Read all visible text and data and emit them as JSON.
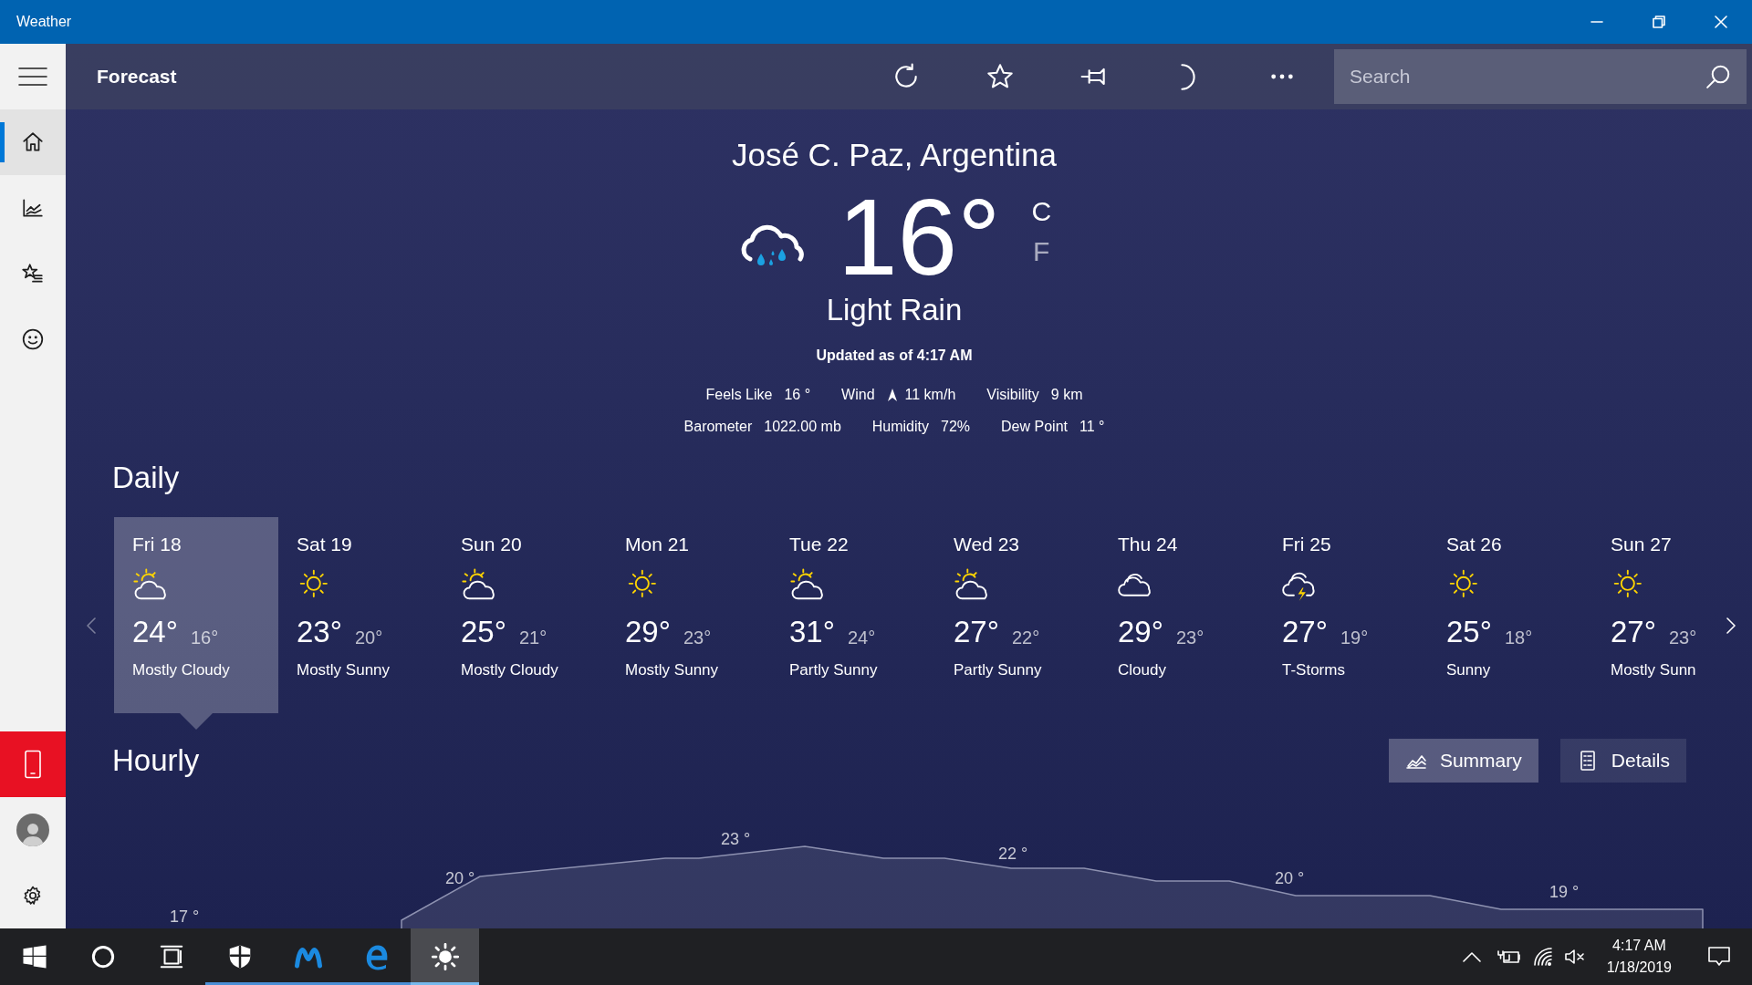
{
  "window": {
    "title": "Weather"
  },
  "sidebar": {
    "items": [
      {
        "kind": "home",
        "selected": true
      },
      {
        "kind": "chart",
        "selected": false
      },
      {
        "kind": "favorites",
        "selected": false
      },
      {
        "kind": "feedback",
        "selected": false
      }
    ],
    "bottom": [
      {
        "kind": "phone"
      },
      {
        "kind": "avatar"
      },
      {
        "kind": "settings"
      }
    ]
  },
  "app_bar": {
    "title": "Forecast",
    "actions": [
      {
        "kind": "refresh"
      },
      {
        "kind": "favorite"
      },
      {
        "kind": "pin"
      },
      {
        "kind": "theme"
      },
      {
        "kind": "more"
      }
    ],
    "search": {
      "placeholder": "Search"
    }
  },
  "current": {
    "location": "José C. Paz, Argentina",
    "temperature": "16°",
    "units": [
      {
        "label": "C",
        "selected": true
      },
      {
        "label": "F",
        "selected": false
      }
    ],
    "condition": "Light Rain",
    "updated": "Updated as of 4:17 AM",
    "details": [
      [
        {
          "label": "Feels Like",
          "value": "16 °",
          "arrow": false
        },
        {
          "label": "Wind",
          "value": "11 km/h",
          "arrow": true
        },
        {
          "label": "Visibility",
          "value": "9 km",
          "arrow": false
        }
      ],
      [
        {
          "label": "Barometer",
          "value": "1022.00 mb",
          "arrow": false
        },
        {
          "label": "Humidity",
          "value": "72%",
          "arrow": false
        },
        {
          "label": "Dew Point",
          "value": "11 °",
          "arrow": false
        }
      ]
    ]
  },
  "daily": {
    "heading": "Daily",
    "days": [
      {
        "day": "Fri 18",
        "kind": "partly",
        "high": "24°",
        "low": "16°",
        "condition": "Mostly Cloudy",
        "selected": true
      },
      {
        "day": "Sat 19",
        "kind": "sunny",
        "high": "23°",
        "low": "20°",
        "condition": "Mostly Sunny",
        "selected": false
      },
      {
        "day": "Sun 20",
        "kind": "partly",
        "high": "25°",
        "low": "21°",
        "condition": "Mostly Cloudy",
        "selected": false
      },
      {
        "day": "Mon 21",
        "kind": "sunny",
        "high": "29°",
        "low": "23°",
        "condition": "Mostly Sunny",
        "selected": false
      },
      {
        "day": "Tue 22",
        "kind": "partly",
        "high": "31°",
        "low": "24°",
        "condition": "Partly Sunny",
        "selected": false
      },
      {
        "day": "Wed 23",
        "kind": "partly",
        "high": "27°",
        "low": "22°",
        "condition": "Partly Sunny",
        "selected": false
      },
      {
        "day": "Thu 24",
        "kind": "cloudy",
        "high": "29°",
        "low": "23°",
        "condition": "Cloudy",
        "selected": false
      },
      {
        "day": "Fri 25",
        "kind": "storm",
        "high": "27°",
        "low": "19°",
        "condition": "T-Storms",
        "selected": false
      },
      {
        "day": "Sat 26",
        "kind": "sunny",
        "high": "25°",
        "low": "18°",
        "condition": "Sunny",
        "selected": false
      },
      {
        "day": "Sun 27",
        "kind": "sunny",
        "high": "27°",
        "low": "23°",
        "condition": "Mostly Sunn",
        "selected": false
      }
    ]
  },
  "hourly": {
    "heading": "Hourly",
    "views": [
      {
        "label": "Summary",
        "kind": "summary",
        "selected": true
      },
      {
        "label": "Details",
        "kind": "details",
        "selected": false
      }
    ],
    "labels": [
      "17 °",
      "20 °",
      "23 °",
      "22 °",
      "20 °",
      "19 °"
    ]
  },
  "taskbar": {
    "apps": [
      {
        "kind": "start",
        "running": false,
        "active": false
      },
      {
        "kind": "cortana",
        "running": false,
        "active": false
      },
      {
        "kind": "taskview",
        "running": false,
        "active": false
      },
      {
        "kind": "shield",
        "running": true,
        "active": false
      },
      {
        "kind": "m-logo",
        "running": true,
        "active": false
      },
      {
        "kind": "browser",
        "running": true,
        "active": false
      },
      {
        "kind": "weather",
        "running": true,
        "active": true
      }
    ],
    "tray": {
      "time": "4:17 AM",
      "date": "1/18/2019"
    }
  }
}
